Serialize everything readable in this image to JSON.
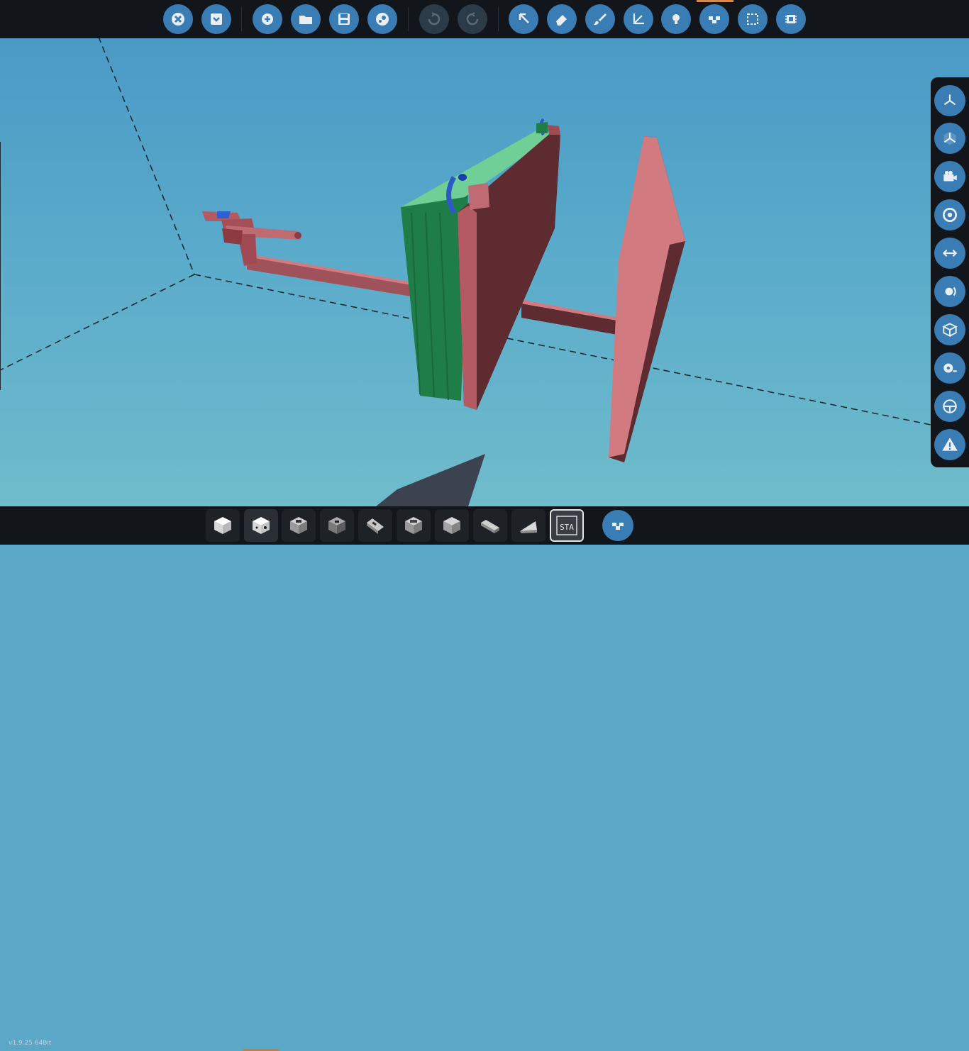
{
  "version_label": "v1.9.25 64Bit",
  "colors": {
    "toolbar_bg": "#121519",
    "button_blue": "#3a7cb4",
    "button_disabled": "#2c3b48",
    "active_marker": "#d08a52",
    "sky_top": "#4a9ac6",
    "sky_bottom": "#6fbccb",
    "block_pink": "#d17a80",
    "block_maroon": "#5e2b30",
    "panel_green": "#6fcf97",
    "panel_dark_green": "#1e7a45"
  },
  "toolbar": {
    "buttons": [
      {
        "icon": "close-icon",
        "state": "enabled"
      },
      {
        "icon": "download-icon",
        "state": "enabled"
      },
      {
        "icon": "add-icon",
        "state": "enabled"
      },
      {
        "icon": "folder-icon",
        "state": "enabled"
      },
      {
        "icon": "save-icon",
        "state": "enabled"
      },
      {
        "icon": "steam-icon",
        "state": "enabled"
      },
      {
        "icon": "undo-icon",
        "state": "disabled"
      },
      {
        "icon": "redo-icon",
        "state": "disabled"
      },
      {
        "icon": "select-cursor-icon",
        "state": "enabled"
      },
      {
        "icon": "eraser-icon",
        "state": "enabled"
      },
      {
        "icon": "paint-brush-icon",
        "state": "enabled"
      },
      {
        "icon": "transform-axes-icon",
        "state": "enabled"
      },
      {
        "icon": "lightbulb-icon",
        "state": "enabled"
      },
      {
        "icon": "logic-nodes-icon",
        "state": "active"
      },
      {
        "icon": "selection-box-icon",
        "state": "enabled"
      },
      {
        "icon": "microchip-icon",
        "state": "enabled"
      }
    ]
  },
  "right_panel": {
    "buttons": [
      {
        "icon": "axes-view-icon"
      },
      {
        "icon": "cube-axes-view-icon"
      },
      {
        "icon": "camera-icon"
      },
      {
        "icon": "target-icon"
      },
      {
        "icon": "transfer-arrows-icon"
      },
      {
        "icon": "center-of-mass-icon"
      },
      {
        "icon": "box-outline-icon"
      },
      {
        "icon": "measure-tape-icon"
      },
      {
        "icon": "seat-icon"
      },
      {
        "icon": "warning-icon"
      }
    ]
  },
  "inventory": {
    "slots": [
      {
        "icon": "block-white-cube-icon"
      },
      {
        "icon": "block-cube-dot-icon",
        "selected": true
      },
      {
        "icon": "block-gray-cube-icon"
      },
      {
        "icon": "block-dark-cube-icon"
      },
      {
        "icon": "block-slab-icon"
      },
      {
        "icon": "block-gray-cube-2-icon"
      },
      {
        "icon": "block-gray-cube-3-icon"
      },
      {
        "icon": "block-long-beam-icon"
      },
      {
        "icon": "block-wedge-icon"
      },
      {
        "icon": "sta-logo-icon",
        "label": "STA"
      }
    ],
    "round_button_icon": "logic-nodes-icon"
  }
}
